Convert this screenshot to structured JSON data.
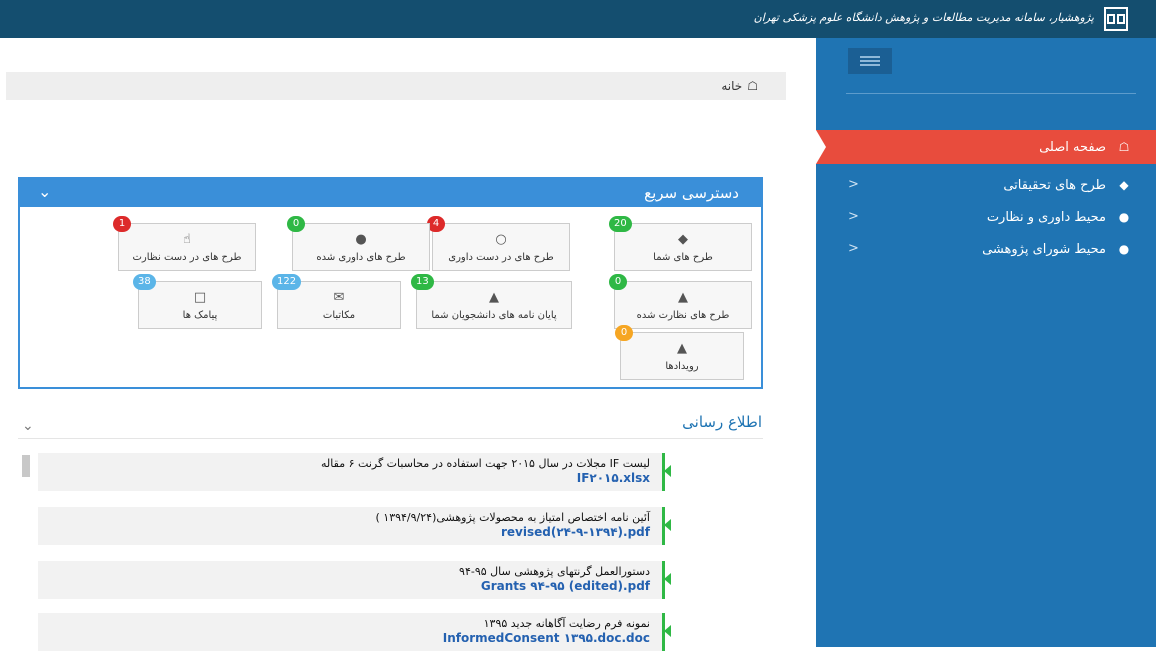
{
  "header": {
    "title": "پژوهشیار، سامانه مدیریت مطالعات و پژوهش دانشگاه علوم پزشکی تهران"
  },
  "sidebar": {
    "items": [
      {
        "label": "صفحه اصلی",
        "icon": "home-icon",
        "active": true
      },
      {
        "label": "طرح های تحقیقاتی",
        "icon": "tags-icon",
        "chevron": "<"
      },
      {
        "label": "محیط داوری و نظارت",
        "icon": "comments-icon",
        "chevron": "<"
      },
      {
        "label": "محیط شورای پژوهشی",
        "icon": "users-icon",
        "chevron": "<"
      }
    ]
  },
  "breadcrumb": {
    "home": "خانه"
  },
  "quick_access": {
    "title": "دسترسی سریع",
    "tiles": [
      {
        "label": "طرح های شما",
        "badge": "20",
        "color": "#2fb845",
        "icon": "tags-icon"
      },
      {
        "label": "طرح های در دست داوری",
        "badge": "4",
        "color": "#dd2a2a",
        "icon": "comments-icon"
      },
      {
        "label": "طرح های داوری شده",
        "badge": "0",
        "color": "#2fb845",
        "icon": "comments-icon"
      },
      {
        "label": "طرح های در دست نظارت",
        "badge": "1",
        "color": "#dd2a2a",
        "icon": "thumbs-up-icon"
      },
      {
        "label": "طرح های نظارت شده",
        "badge": "0",
        "color": "#2fb845",
        "icon": "thumbs-up-icon"
      },
      {
        "label": "پایان نامه های دانشجویان شما",
        "badge": "13",
        "color": "#2fb845",
        "icon": "thumbs-up-icon"
      },
      {
        "label": "مکاتبات",
        "badge": "122",
        "color": "#5bb5e8",
        "icon": "envelope-icon"
      },
      {
        "label": "پیامک ها",
        "badge": "38",
        "color": "#5bb5e8",
        "icon": "tablet-icon"
      },
      {
        "label": "رویدادها",
        "badge": "0",
        "color": "#f6a623",
        "icon": "warning-icon"
      }
    ]
  },
  "news": {
    "title": "اطلاع رسانی",
    "items": [
      {
        "text": "لیست IF مجلات در سال ۲۰۱۵ جهت استفاده در محاسبات گرنت ۶ مقاله",
        "link": "IF۲۰۱۵.xlsx"
      },
      {
        "text": "آئین نامه اختصاص امتیاز به محصولات پژوهشی(۱۳۹۴/۹/۲۴ )",
        "link": "revised(۲۴-۹-۱۳۹۴).pdf"
      },
      {
        "text": "دستورالعمل گرنتهای پژوهشی سال ۹۵-۹۴",
        "link": "Grants ۹۴-۹۵ (edited).pdf"
      },
      {
        "text": "نمونه فرم رضایت آگاهانه جدید ۱۳۹۵",
        "link": "InformedConsent ۱۳۹۵.doc.doc"
      }
    ]
  }
}
